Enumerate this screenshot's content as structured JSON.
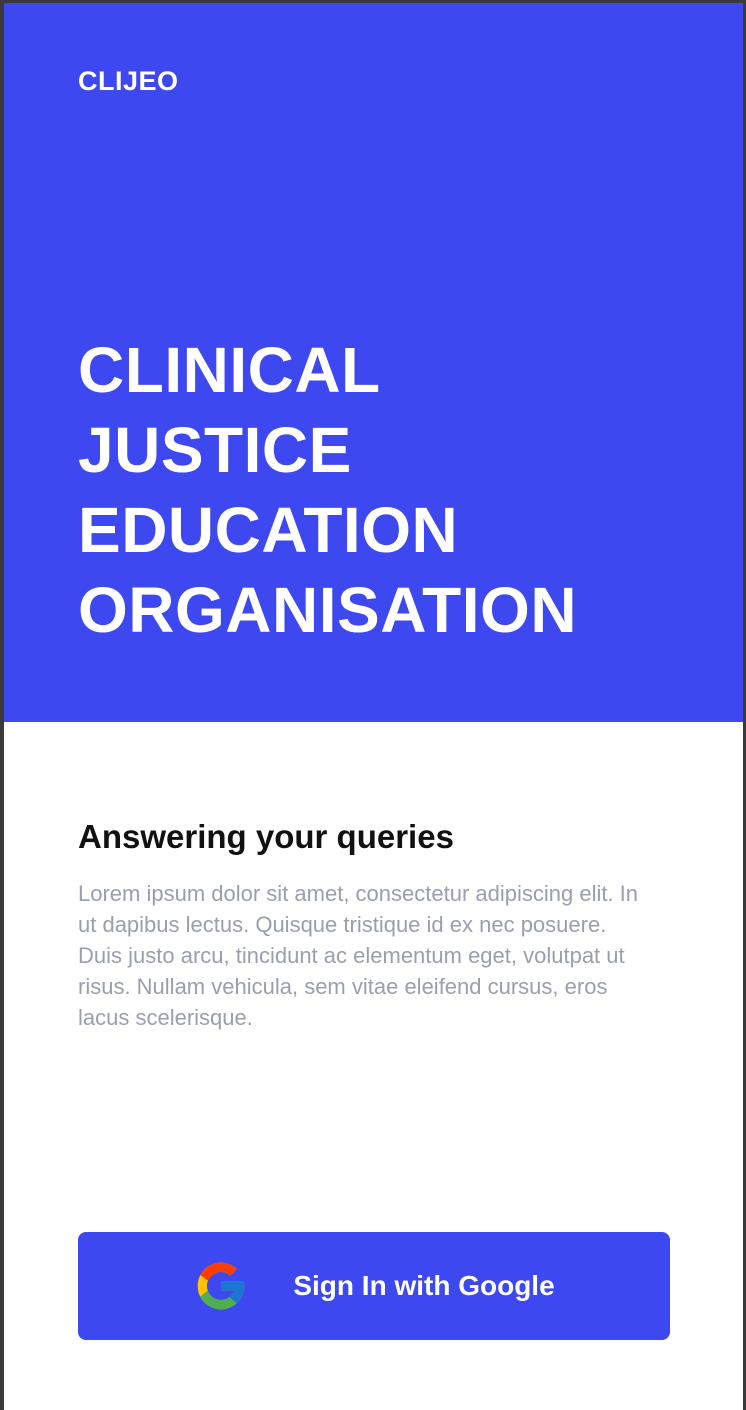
{
  "brand": {
    "name": "CLIJEO"
  },
  "hero": {
    "title_lines": [
      "CLINICAL",
      "JUSTICE",
      "EDUCATION",
      "ORGANISATION"
    ],
    "background_color": "#3d48f0"
  },
  "section": {
    "title": "Answering your queries",
    "body": "Lorem ipsum dolor sit amet, consectetur adipiscing elit. In ut dapibus lectus. Quisque tristique id ex nec posuere. Duis justo arcu, tincidunt ac elementum eget, volutpat ut risus. Nullam vehicula, sem vitae eleifend cursus, eros lacus scelerisque."
  },
  "signin": {
    "label": "Sign In with Google",
    "icon": "google-icon",
    "button_color": "#3d48f0"
  }
}
